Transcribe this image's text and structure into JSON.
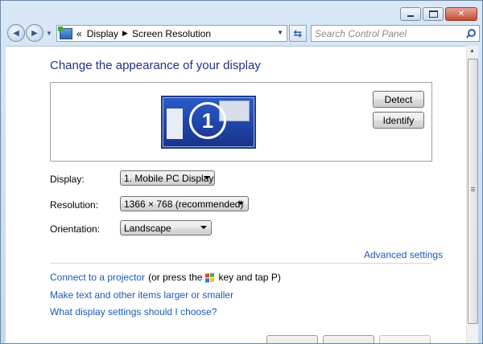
{
  "address_bar": {
    "breadcrumbs": [
      "«",
      "Display",
      "Screen Resolution"
    ]
  },
  "search": {
    "placeholder": "Search Control Panel"
  },
  "page": {
    "title": "Change the appearance of your display",
    "monitor_number": "1",
    "detect_label": "Detect",
    "identify_label": "Identify"
  },
  "settings": {
    "display_label": "Display:",
    "display_value": "1. Mobile PC Display",
    "resolution_label": "Resolution:",
    "resolution_value": "1366 × 768 (recommended)",
    "orientation_label": "Orientation:",
    "orientation_value": "Landscape"
  },
  "links": {
    "advanced_settings": "Advanced settings",
    "projector_link": "Connect to a projector",
    "projector_text_before": "(or press the",
    "projector_text_after": "key and tap P)",
    "larger_text": "Make text and other items larger or smaller",
    "which_settings": "What display settings should I choose?"
  },
  "icons": {
    "back": "back-arrow-icon",
    "forward": "forward-arrow-icon",
    "refresh": "refresh-icon",
    "search": "search-icon",
    "windows_key": "windows-logo-icon",
    "control_panel": "control-panel-icon"
  },
  "colors": {
    "title": "#1e3287",
    "link": "#1b59b8",
    "close_button": "#c24a32"
  }
}
